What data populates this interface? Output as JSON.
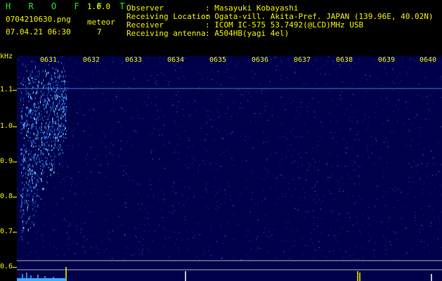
{
  "app": {
    "title": "H R O F F T",
    "version": "1.0.0",
    "filename": "0704210630.png",
    "datetime": "07.04.21 06:30",
    "meteor_label": "meteor",
    "meteor_count": "7"
  },
  "info": {
    "rows": [
      {
        "label": "Observer",
        "value": ": Masayuki Kobayashi"
      },
      {
        "label": "Receiving Location",
        "value": ": Ogata-vill. Akita-Pref. JAPAN (139.96E, 40.02N)"
      },
      {
        "label": "Receiver",
        "value": ": ICOM IC-575 53.7492(@LCD)MHz USB"
      },
      {
        "label": "Receiving antenna",
        "value": ": A504HB(yagi 4el)"
      }
    ]
  },
  "axis": {
    "unit": "kHz",
    "freq_labels": [
      "1.1",
      "1.0",
      "0.9",
      "0.8",
      "0.7",
      "0.6"
    ],
    "time_labels": [
      "0631",
      "0632",
      "0633",
      "0634",
      "0635",
      "0636",
      "0637",
      "0638",
      "0639",
      "0640"
    ]
  },
  "colors": {
    "background": "#00004a",
    "signal": "#3fa8ff",
    "header_green": "#29e629",
    "header_yellow": "#f2f200"
  }
}
